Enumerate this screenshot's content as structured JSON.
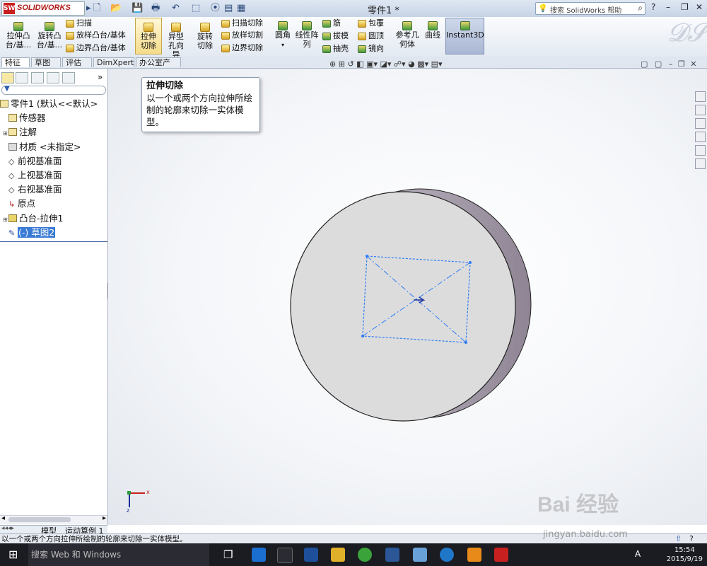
{
  "titlebar": {
    "brand": "SOLIDWORKS",
    "brand_icon": "SW",
    "doc_title": "零件1 *",
    "help_placeholder": "搜索 SolidWorks 帮助",
    "help_icon": "?",
    "winbtns": [
      "?",
      "–",
      "❐",
      "✕"
    ]
  },
  "ribbon": {
    "boss_extrude": "拉伸凸台/基...",
    "revolve_boss": "旋转凸台/基...",
    "sweep": "扫描",
    "loft_boss": "放样凸台/基体",
    "boundary_boss": "边界凸台/基体",
    "extrude_cut": "拉伸切除",
    "hole_wizard": "异型孔向导",
    "revolve_cut": "旋转切除",
    "sweep_cut": "扫描切除",
    "loft_cut": "放样切割",
    "boundary_cut": "边界切除",
    "fillet": "圆角",
    "linear_pattern": "线性阵列",
    "rib": "筋",
    "draft": "拔模",
    "shell": "抽壳",
    "wrap": "包覆",
    "dome": "圆顶",
    "mirror": "镜向",
    "ref_geometry": "参考几何体",
    "curves": "曲线",
    "instant3d": "Instant3D"
  },
  "tabs": [
    "特征",
    "草图",
    "评估",
    "DimXpert",
    "办公室产品"
  ],
  "tree": {
    "root": "零件1 (默认<<默认>",
    "items": [
      "传感器",
      "注解",
      "材质 <未指定>",
      "前视基准面",
      "上视基准面",
      "右视基准面",
      "原点",
      "凸台-拉伸1",
      "(-) 草图2"
    ]
  },
  "tooltip": {
    "title": "拉伸切除",
    "body": "以一个或两个方向拉伸所绘制的轮廓来切除一实体模型。"
  },
  "bottom_tabs": [
    "模型",
    "运动算例 1"
  ],
  "status_text": "以一个或两个方向拉伸所绘制的轮廓来切除一实体模型。",
  "triad": {
    "x": "x",
    "z": "z"
  },
  "taskbar": {
    "search_placeholder": "搜索 Web 和 Windows",
    "time": "15:54",
    "date": "2015/9/19",
    "lang": "A"
  },
  "watermark": {
    "main": "Bai 经验",
    "url": "jingyan.baidu.com"
  },
  "colors": {
    "accent": "#3a7bd5",
    "sketch": "#2e7cf6",
    "brand": "#c8201e"
  }
}
